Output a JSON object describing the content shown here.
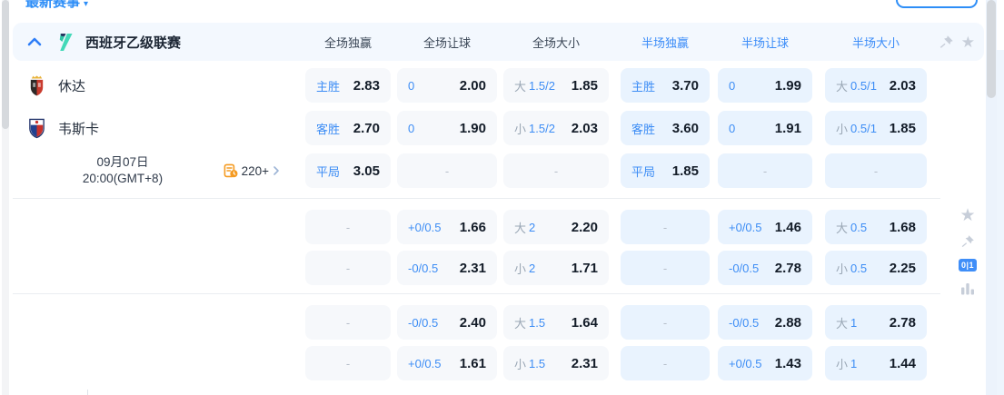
{
  "top": {
    "cut_label": "最新赛事",
    "cut_caret": "▾"
  },
  "header": {
    "league": "西班牙乙级联赛",
    "columns": [
      "全场独赢",
      "全场让球",
      "全场大小",
      "半场独赢",
      "半场让球",
      "半场大小"
    ]
  },
  "match": {
    "home": "休达",
    "away": "韦斯卡",
    "date": "09月07日",
    "time": "20:00(GMT+8)",
    "markets_count": "220+"
  },
  "rows": {
    "r0": {
      "c0": {
        "l": "主胜",
        "v": "2.83"
      },
      "c1": {
        "l": "0",
        "v": "2.00"
      },
      "c2": {
        "g": "大",
        "s": "1.5/2",
        "v": "1.85"
      },
      "c3": {
        "l": "主胜",
        "v": "3.70"
      },
      "c4": {
        "l": "0",
        "v": "1.99"
      },
      "c5": {
        "g": "大",
        "s": "0.5/1",
        "v": "2.03"
      }
    },
    "r1": {
      "c0": {
        "l": "客胜",
        "v": "2.70"
      },
      "c1": {
        "l": "0",
        "v": "1.90"
      },
      "c2": {
        "g": "小",
        "s": "1.5/2",
        "v": "2.03"
      },
      "c3": {
        "l": "客胜",
        "v": "3.60"
      },
      "c4": {
        "l": "0",
        "v": "1.91"
      },
      "c5": {
        "g": "小",
        "s": "0.5/1",
        "v": "1.85"
      }
    },
    "r2": {
      "c0": {
        "l": "平局",
        "v": "3.05"
      },
      "c1": {
        "v": "-"
      },
      "c2": {
        "v": "-"
      },
      "c3": {
        "l": "平局",
        "v": "1.85"
      },
      "c4": {
        "v": "-"
      },
      "c5": {
        "v": "-"
      }
    },
    "r3": {
      "c0": {
        "v": "-"
      },
      "c1": {
        "l": "+0/0.5",
        "v": "1.66"
      },
      "c2": {
        "g": "大",
        "s": "2",
        "v": "2.20"
      },
      "c3": {
        "v": "-"
      },
      "c4": {
        "l": "+0/0.5",
        "v": "1.46"
      },
      "c5": {
        "g": "大",
        "s": "0.5",
        "v": "1.68"
      }
    },
    "r4": {
      "c0": {
        "v": "-"
      },
      "c1": {
        "l": "-0/0.5",
        "v": "2.31"
      },
      "c2": {
        "g": "小",
        "s": "2",
        "v": "1.71"
      },
      "c3": {
        "v": "-"
      },
      "c4": {
        "l": "-0/0.5",
        "v": "2.78"
      },
      "c5": {
        "g": "小",
        "s": "0.5",
        "v": "2.25"
      }
    },
    "r5": {
      "c0": {
        "v": "-"
      },
      "c1": {
        "l": "-0/0.5",
        "v": "2.40"
      },
      "c2": {
        "g": "大",
        "s": "1.5",
        "v": "1.64"
      },
      "c3": {
        "v": "-"
      },
      "c4": {
        "l": "-0/0.5",
        "v": "2.88"
      },
      "c5": {
        "g": "大",
        "s": "1",
        "v": "2.78"
      }
    },
    "r6": {
      "c0": {
        "v": "-"
      },
      "c1": {
        "l": "+0/0.5",
        "v": "1.61"
      },
      "c2": {
        "g": "小",
        "s": "1.5",
        "v": "2.31"
      },
      "c3": {
        "v": "-"
      },
      "c4": {
        "l": "+0/0.5",
        "v": "1.43"
      },
      "c5": {
        "g": "小",
        "s": "1",
        "v": "1.44"
      }
    }
  },
  "side_rail": {
    "badge": "0|1"
  },
  "colors": {
    "accent_blue": "#2e8ef7",
    "label_blue": "#3d8df5",
    "label_gray": "#9aa7b5",
    "value_dark": "#131c28",
    "band_bg": "#f3f8fe",
    "ft_cell_bg": "#f6f8fb",
    "ht_cell_bg": "#e9f3fe",
    "logo_teal": "#3fd6b5",
    "markets_orange": "#f59b22"
  }
}
